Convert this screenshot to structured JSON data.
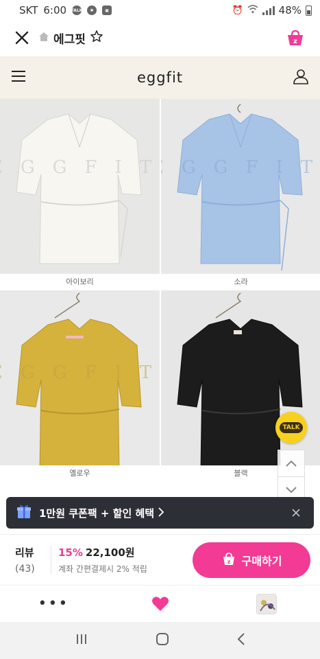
{
  "status_bar": {
    "carrier": "SKT",
    "time": "6:00",
    "status_icons": [
      "talk-icon",
      "settings-gear-icon",
      "gallery-icon"
    ],
    "battery": "48%"
  },
  "app_header": {
    "shop_name": "에그핏",
    "icons": [
      "close-icon",
      "home-icon",
      "star-icon",
      "shopping-bag-icon"
    ]
  },
  "site_header": {
    "logo": "eggfit",
    "icons": [
      "hamburger-menu-icon",
      "user-icon"
    ]
  },
  "products": [
    {
      "label": "아이보리",
      "color": "#f4f2ec"
    },
    {
      "label": "소라",
      "color": "#a9c5e8"
    },
    {
      "label": "옐로우",
      "color": "#d7b43f"
    },
    {
      "label": "블랙",
      "color": "#1e1e1e"
    }
  ],
  "toast": {
    "text": "1만원 쿠폰팩 + 할인 혜택",
    "icons": [
      "gift-icon",
      "chevron-right-icon",
      "close-icon"
    ]
  },
  "purchase": {
    "review_label": "리뷰",
    "review_count": "(43)",
    "discount": "15%",
    "price": "22,100원",
    "note": "계좌 간편결제시 2% 적립",
    "buy_label": "구매하기"
  },
  "bottom_nav": {
    "icons": [
      "more-icon",
      "heart-icon",
      "recent-product-thumbnail"
    ]
  },
  "system_nav": {
    "icons": [
      "recent-apps-icon",
      "home-button-icon",
      "back-icon"
    ]
  },
  "colors": {
    "accent_pink": "#f33a94",
    "site_header_bg": "#f5f1e8",
    "toast_bg": "#2c2f35",
    "talk_yellow": "#f7d11e"
  }
}
